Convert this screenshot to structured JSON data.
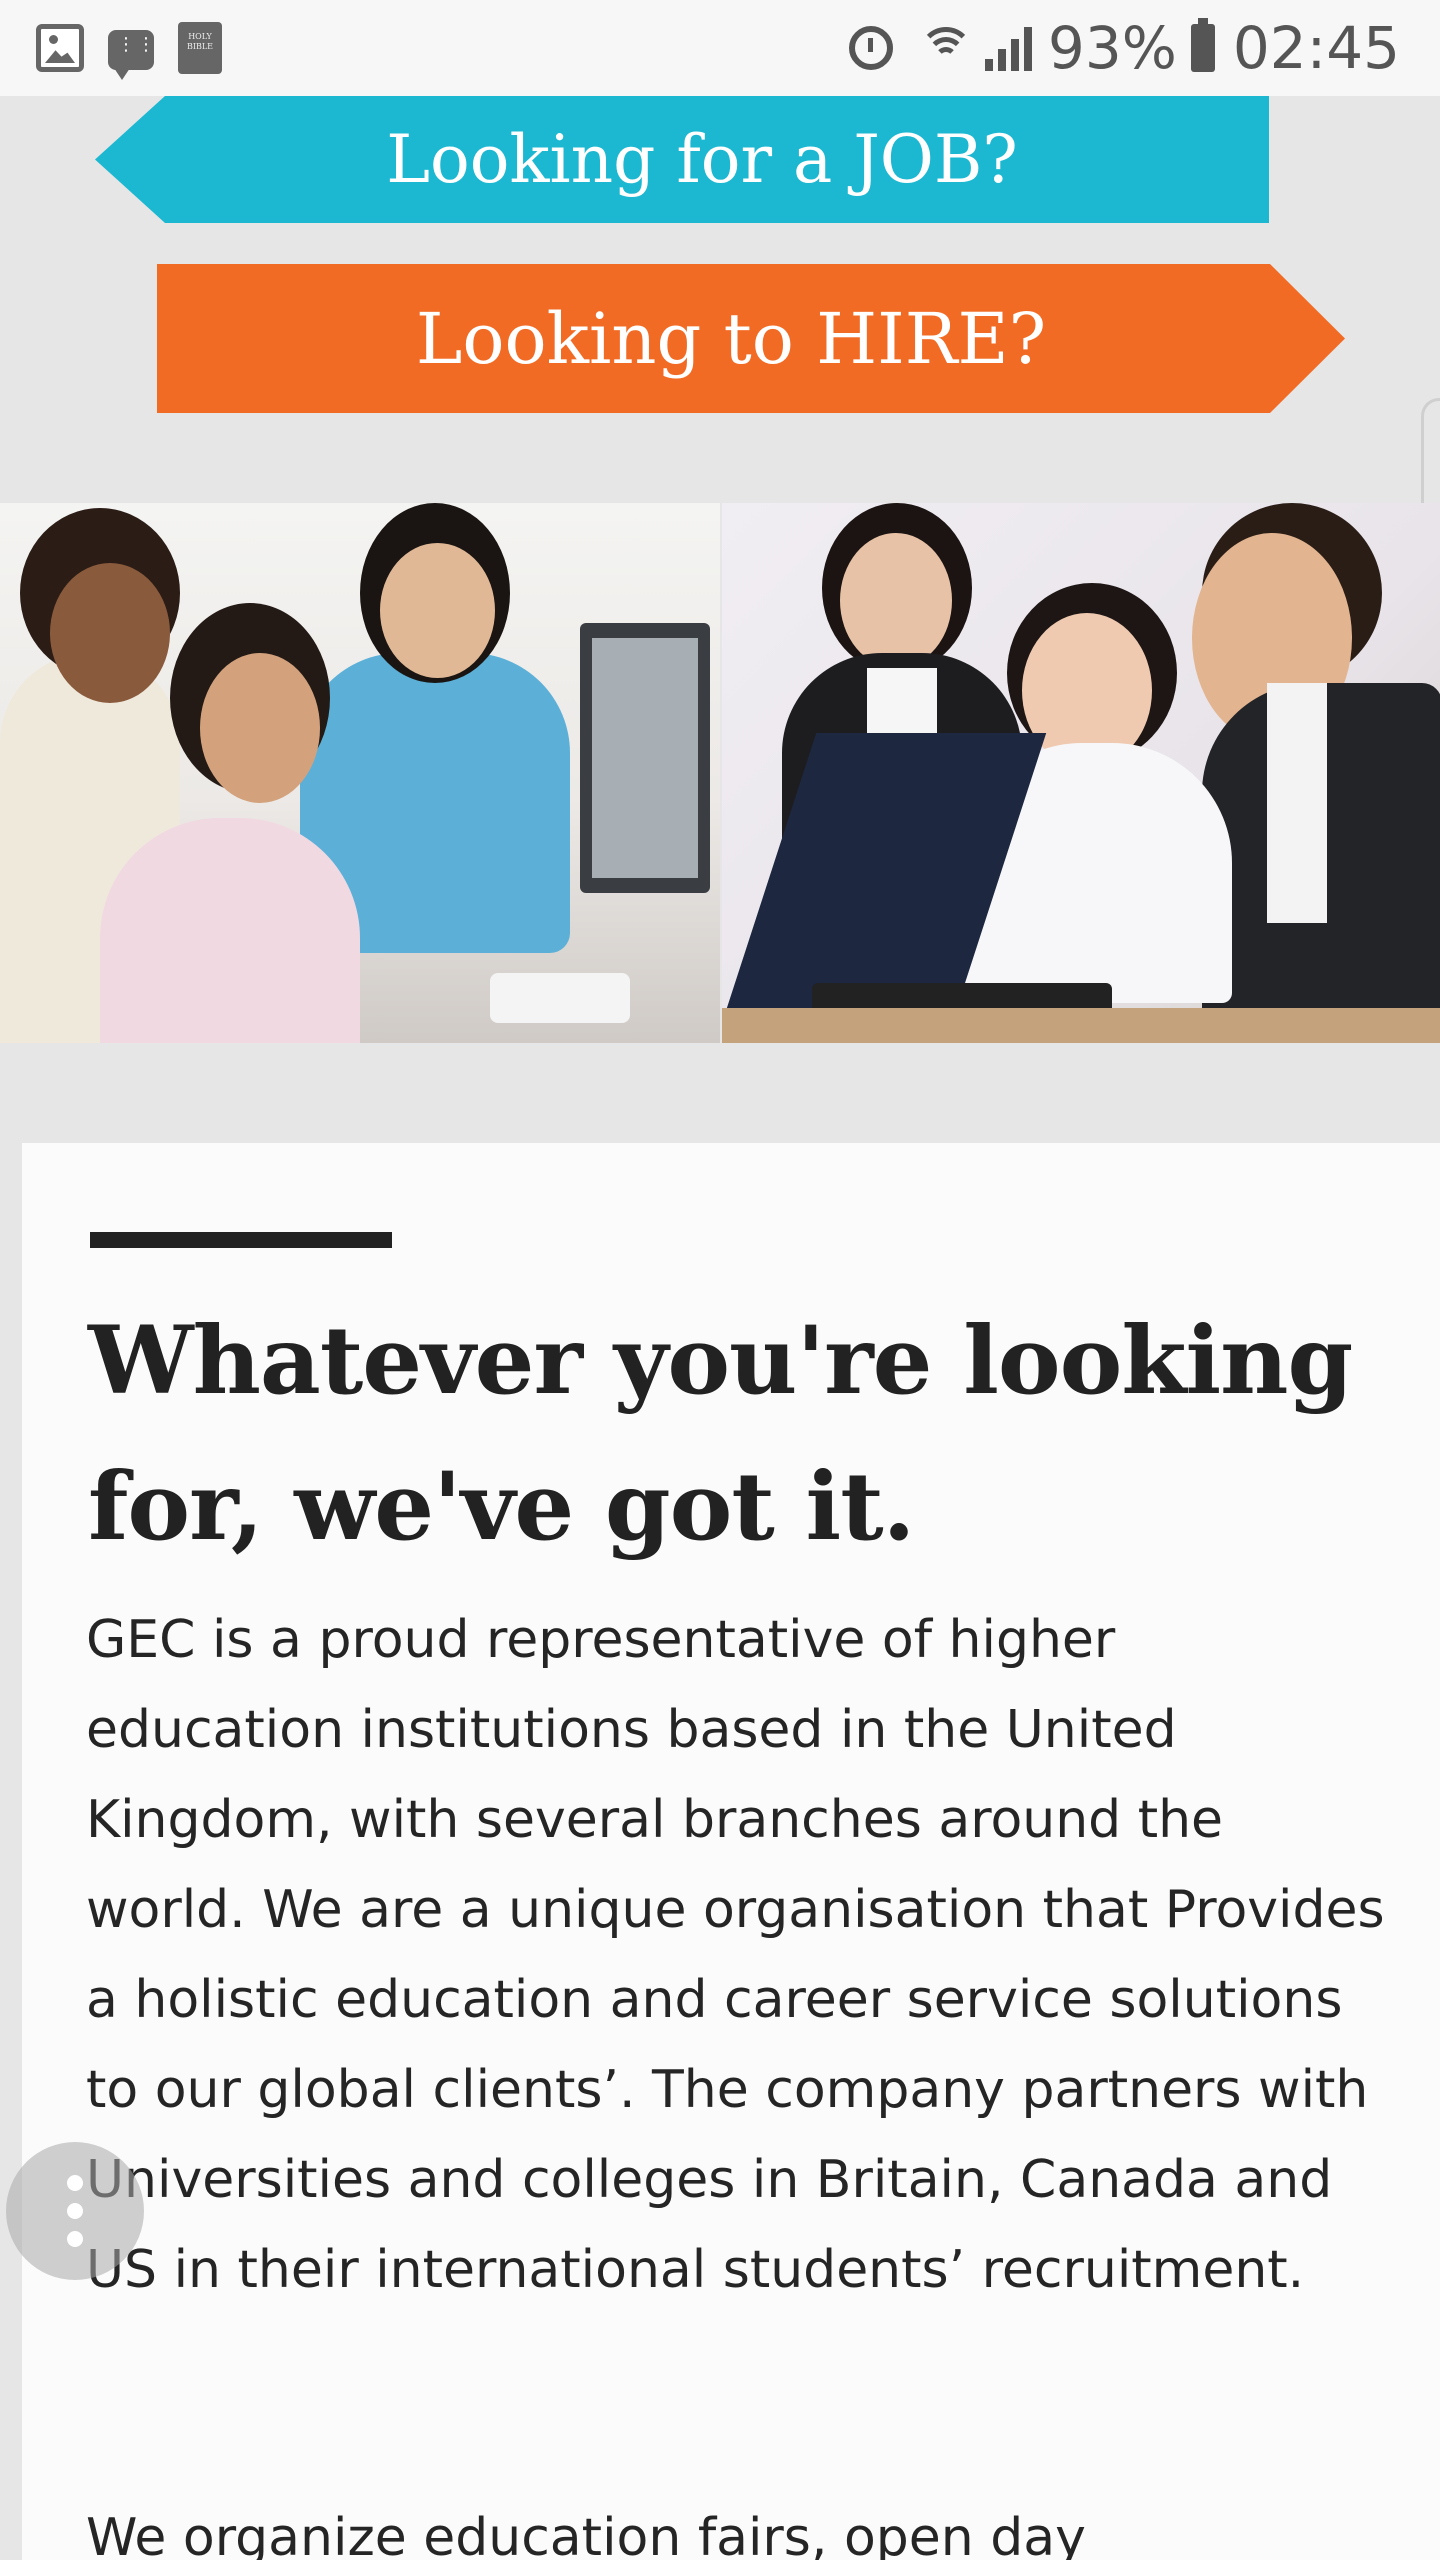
{
  "status_bar": {
    "battery_percent": "93%",
    "time": "02:45",
    "bible_icon_text": "HOLY BIBLE",
    "icons": [
      "image-icon",
      "message-icon",
      "bible-app-icon",
      "alarm-icon",
      "wifi-icon",
      "signal-icon",
      "battery-icon"
    ]
  },
  "cta": {
    "job_label": "Looking for a JOB?",
    "hire_label": "Looking to HIRE?",
    "job_color": "#1cb7d1",
    "hire_color": "#f26b24"
  },
  "photos": [
    "students-at-computer-photo",
    "professionals-at-laptop-photo"
  ],
  "content": {
    "headline": "Whatever you're looking for, we've got it.",
    "paragraph_1": "GEC is a proud representative of higher education institutions based in the United Kingdom, with several branches around the world. We are a unique organisation that Provides a holistic education and career service solutions to our global clients’. The company partners with Universities and colleges in Britain, Canada and US in their international students’ recruitment.",
    "paragraph_2": "We organize education fairs, open day"
  },
  "fab": {
    "icon": "more-vert-icon"
  }
}
